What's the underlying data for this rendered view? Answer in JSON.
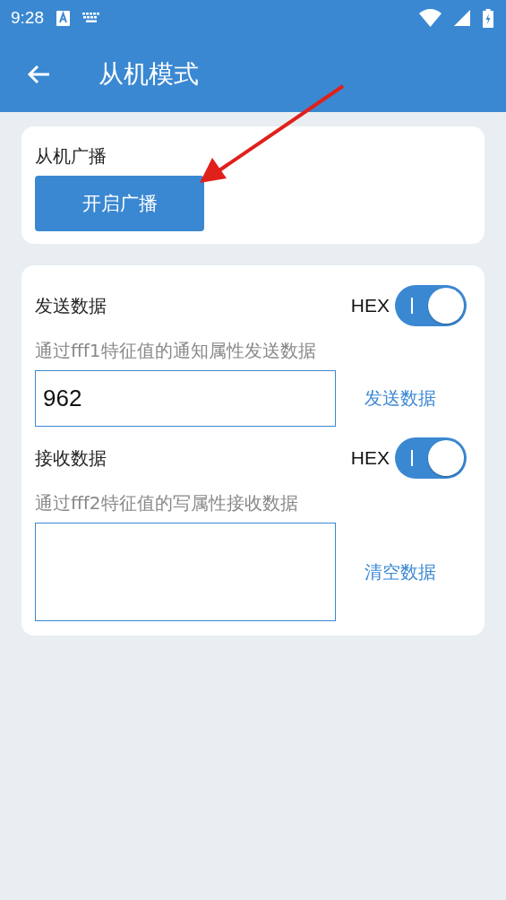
{
  "status_bar": {
    "time": "9:28"
  },
  "app_bar": {
    "title": "从机模式"
  },
  "broadcast": {
    "title": "从机广播",
    "button": "开启广播"
  },
  "sections": [
    {
      "title": "发送数据",
      "hex_label": "HEX",
      "hex_on": true,
      "hint": "通过fff1特征值的通知属性发送数据",
      "value": "962",
      "action": "发送数据",
      "kind": "single"
    },
    {
      "title": "接收数据",
      "hex_label": "HEX",
      "hex_on": true,
      "hint": "通过fff2特征值的写属性接收数据",
      "action": "清空数据",
      "kind": "multi"
    }
  ]
}
